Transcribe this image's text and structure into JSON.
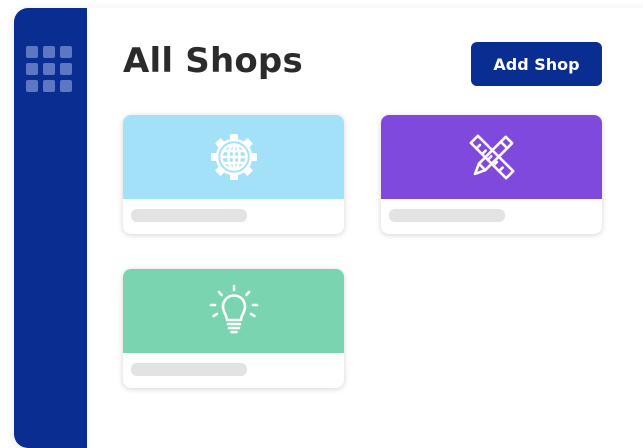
{
  "header": {
    "title": "All Shops",
    "add_button_label": "Add Shop"
  },
  "sidebar": {
    "menu_icon": "grid-icon"
  },
  "shops": [
    {
      "icon": "globe-gear-icon",
      "color": "#a3e1f9"
    },
    {
      "icon": "pencil-ruler-icon",
      "color": "#8049dd"
    },
    {
      "icon": "lightbulb-icon",
      "color": "#7bd4b0"
    }
  ],
  "colors": {
    "brand": "#0a2d91",
    "placeholder_bar": "#e3e3e3"
  }
}
